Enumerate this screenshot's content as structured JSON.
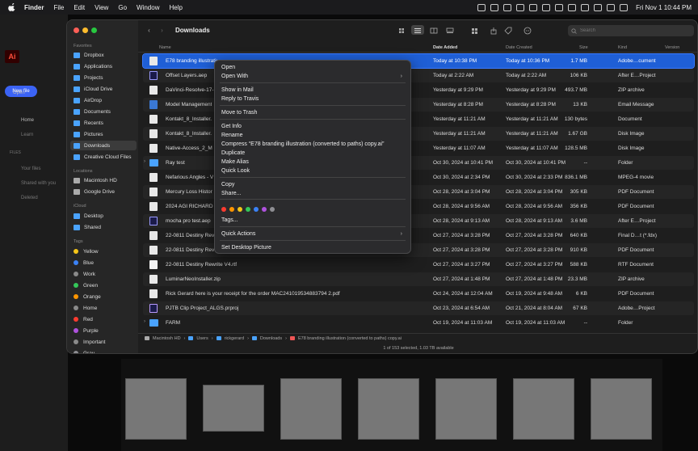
{
  "menubar": {
    "items": [
      "Finder",
      "File",
      "Edit",
      "View",
      "Go",
      "Window",
      "Help"
    ],
    "clock": "Fri Nov 1  10:44 PM"
  },
  "bg_app": {
    "logo": "Ai",
    "new_file": "New file",
    "open": "Open",
    "home": "Home",
    "learn": "Learn",
    "files_head": "FILES",
    "your_files": "Your files",
    "shared": "Shared with you",
    "deleted": "Deleted"
  },
  "finder": {
    "title": "Downloads",
    "search_placeholder": "Search",
    "sidebar": {
      "favorites_head": "Favorites",
      "favorites": [
        "Dropbox",
        "Applications",
        "Projects",
        "iCloud Drive",
        "AirDrop",
        "Documents",
        "Recents",
        "Pictures",
        "Downloads",
        "Creative Cloud Files"
      ],
      "locations_head": "Locations",
      "locations": [
        "Macintosh HD",
        "Google Drive"
      ],
      "icloud_head": "iCloud",
      "icloud": [
        "Desktop",
        "Shared"
      ],
      "tags_head": "Tags",
      "tags": [
        {
          "label": "Yellow",
          "color": "#f5c518"
        },
        {
          "label": "Blue",
          "color": "#3b82f6"
        },
        {
          "label": "Work",
          "color": "#8a8a8a"
        },
        {
          "label": "Green",
          "color": "#34c759"
        },
        {
          "label": "Orange",
          "color": "#ff9500"
        },
        {
          "label": "Home",
          "color": "#8a8a8a"
        },
        {
          "label": "Red",
          "color": "#ff3b30"
        },
        {
          "label": "Purple",
          "color": "#af52de"
        },
        {
          "label": "Important",
          "color": "#8a8a8a"
        },
        {
          "label": "Gray",
          "color": "#8e8e93"
        }
      ]
    },
    "columns": {
      "name": "Name",
      "date_added": "Date Added",
      "date_created": "Date Created",
      "size": "Size",
      "kind": "Kind",
      "version": "Version"
    },
    "rows": [
      {
        "name": "E78 branding illustration (converted to paths) copy.ai",
        "added": "Today at 10:38 PM",
        "created": "Today at 10:36 PM",
        "size": "1.7 MB",
        "kind": "Adobe…cument",
        "icon": "doc"
      },
      {
        "name": "Offset Layers.aep",
        "added": "Today at 2:22 AM",
        "created": "Today at 2:22 AM",
        "size": "106 KB",
        "kind": "After E…Project",
        "icon": "ae"
      },
      {
        "name": "DaVinci-Resolve-17-",
        "added": "Yesterday at 9:29 PM",
        "created": "Yesterday at 9:29 PM",
        "size": "493.7 MB",
        "kind": "ZIP archive",
        "icon": "doc"
      },
      {
        "name": "Model Management",
        "added": "Yesterday at 8:28 PM",
        "created": "Yesterday at 8:28 PM",
        "size": "13 KB",
        "kind": "Email Message",
        "icon": "blue"
      },
      {
        "name": "Kontakt_8_Installer.",
        "added": "Yesterday at 11:21 AM",
        "created": "Yesterday at 11:21 AM",
        "size": "130 bytes",
        "kind": "Document",
        "icon": "doc"
      },
      {
        "name": "Kontakt_8_Installer.",
        "added": "Yesterday at 11:21 AM",
        "created": "Yesterday at 11:21 AM",
        "size": "1.67 GB",
        "kind": "Disk Image",
        "icon": "doc"
      },
      {
        "name": "Native-Access_2_M",
        "added": "Yesterday at 11:07 AM",
        "created": "Yesterday at 11:07 AM",
        "size": "128.5 MB",
        "kind": "Disk Image",
        "icon": "doc"
      },
      {
        "name": "Ray test",
        "added": "Oct 30, 2024 at 10:41 PM",
        "created": "Oct 30, 2024 at 10:41 PM",
        "size": "--",
        "kind": "Folder",
        "icon": "folder",
        "chev": "›"
      },
      {
        "name": "Nefarious Angles - V",
        "added": "Oct 30, 2024 at 2:34 PM",
        "created": "Oct 30, 2024 at 2:33 PM",
        "size": "836.1 MB",
        "kind": "MPEG-4 movie",
        "icon": "doc"
      },
      {
        "name": "Mercury Loss Histor",
        "added": "Oct 28, 2024 at 3:04 PM",
        "created": "Oct 28, 2024 at 3:04 PM",
        "size": "305 KB",
        "kind": "PDF Document",
        "icon": "doc"
      },
      {
        "name": "2024 AGI RICHARD",
        "added": "Oct 28, 2024 at 9:56 AM",
        "created": "Oct 28, 2024 at 9:56 AM",
        "size": "356 KB",
        "kind": "PDF Document",
        "icon": "doc"
      },
      {
        "name": "mocha pro test.aep",
        "added": "Oct 28, 2024 at 9:13 AM",
        "created": "Oct 28, 2024 at 9:13 AM",
        "size": "3.6 MB",
        "kind": "After E…Project",
        "icon": "ae"
      },
      {
        "name": "22-0811 Destiny Rev",
        "added": "Oct 27, 2024 at 3:28 PM",
        "created": "Oct 27, 2024 at 3:28 PM",
        "size": "640 KB",
        "kind": "Final D…t (*.fdx)",
        "icon": "doc"
      },
      {
        "name": "22-0811 Destiny Rev",
        "added": "Oct 27, 2024 at 3:28 PM",
        "created": "Oct 27, 2024 at 3:28 PM",
        "size": "910 KB",
        "kind": "PDF Document",
        "icon": "doc"
      },
      {
        "name": "22-0811 Destiny Rewrite V4.rtf",
        "added": "Oct 27, 2024 at 3:27 PM",
        "created": "Oct 27, 2024 at 3:27 PM",
        "size": "588 KB",
        "kind": "RTF Document",
        "icon": "rtf"
      },
      {
        "name": "LuminarNeoInstaller.zip",
        "added": "Oct 27, 2024 at 1:48 PM",
        "created": "Oct 27, 2024 at 1:48 PM",
        "size": "23.3 MB",
        "kind": "ZIP archive",
        "icon": "doc"
      },
      {
        "name": "Rick Gerard here is your receipt for the order MAC241019534883794 2.pdf",
        "added": "Oct 24, 2024 at 12:04 AM",
        "created": "Oct 19, 2024 at 9:48 AM",
        "size": "6 KB",
        "kind": "PDF Document",
        "icon": "doc"
      },
      {
        "name": "PJTB Clip Project_ALGS.prproj",
        "added": "Oct 23, 2024 at 6:54 AM",
        "created": "Oct 21, 2024 at 8:04 AM",
        "size": "67 KB",
        "kind": "Adobe…Project",
        "icon": "pr"
      },
      {
        "name": "FARM",
        "added": "Oct 19, 2024 at 11:03 AM",
        "created": "Oct 19, 2024 at 11:03 AM",
        "size": "--",
        "kind": "Folder",
        "icon": "folder",
        "chev": "›"
      }
    ],
    "path": [
      "Macintosh HD",
      "Users",
      "rickgerard",
      "Downloads",
      "E78 branding illustration (converted to paths) copy.ai"
    ],
    "status": "1 of 153 selected, 1.03 TB available"
  },
  "context_menu": {
    "items": [
      {
        "label": "Open"
      },
      {
        "label": "Open With",
        "arrow": "›"
      },
      {
        "label": "Show in Mail"
      },
      {
        "label": "Reply to Travis"
      },
      {
        "label": "Move to Trash"
      },
      {
        "label": "Get Info"
      },
      {
        "label": "Rename"
      },
      {
        "label": "Compress “E78 branding illustration (converted to paths) copy.ai”"
      },
      {
        "label": "Duplicate"
      },
      {
        "label": "Make Alias"
      },
      {
        "label": "Quick Look"
      },
      {
        "label": "Copy"
      },
      {
        "label": "Share..."
      },
      {
        "label": "Tags..."
      },
      {
        "label": "Quick Actions",
        "arrow": "›"
      },
      {
        "label": "Set Desktop Picture"
      }
    ],
    "tag_colors": [
      "#ff3b30",
      "#ff9500",
      "#f5c518",
      "#34c759",
      "#3b82f6",
      "#af52de",
      "#8e8e93"
    ]
  }
}
